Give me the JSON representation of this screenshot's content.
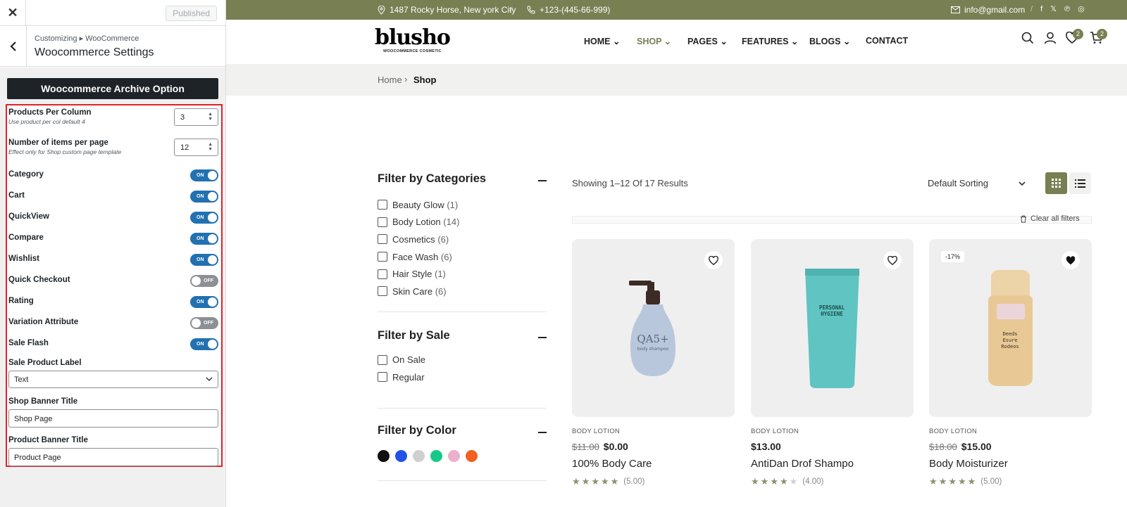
{
  "customizer": {
    "close_icon": "close-icon",
    "publish_label": "Published",
    "back_icon": "chevron-left-icon",
    "breadcrumb": "Customizing ▸ WooCommerce",
    "title": "Woocommerce Settings",
    "section_title": "Woocommerce Archive Option",
    "products_per_column": {
      "label": "Products Per Column",
      "desc": "Use product per col default 4",
      "value": "3"
    },
    "items_per_page": {
      "label": "Number of items per page",
      "desc": "Effect only for Shop custom page template",
      "value": "12"
    },
    "toggles": [
      {
        "label": "Category",
        "state": "ON"
      },
      {
        "label": "Cart",
        "state": "ON"
      },
      {
        "label": "QuickView",
        "state": "ON"
      },
      {
        "label": "Compare",
        "state": "ON"
      },
      {
        "label": "Wishlist",
        "state": "ON"
      },
      {
        "label": "Quick Checkout",
        "state": "OFF"
      },
      {
        "label": "Rating",
        "state": "ON"
      },
      {
        "label": "Variation Attribute",
        "state": "OFF"
      },
      {
        "label": "Sale Flash",
        "state": "ON"
      }
    ],
    "sale_label": {
      "label": "Sale Product Label",
      "value": "Text"
    },
    "shop_banner": {
      "label": "Shop Banner Title",
      "value": "Shop Page"
    },
    "product_banner": {
      "label": "Product Banner Title",
      "value": "Product Page"
    },
    "colors": {
      "accent": "#2271b1",
      "highlight_border": "#e0222a"
    }
  },
  "site": {
    "topbar": {
      "address": "1487 Rocky Horse, New york City",
      "phone": "+123-(445-66-999)",
      "email": "info@gmail.com",
      "social": [
        "facebook-icon",
        "x-icon",
        "pinterest-icon",
        "instagram-icon"
      ]
    },
    "logo": {
      "word": "blusho",
      "tagline": "WOOCOMMERCE COSMETIC"
    },
    "menu": [
      {
        "label": "HOME"
      },
      {
        "label": "SHOP"
      },
      {
        "label": "PAGES"
      },
      {
        "label": "FEATURES"
      },
      {
        "label": "BLOGS"
      },
      {
        "label": "CONTACT"
      }
    ],
    "wishlist_count": "2",
    "cart_count": "2",
    "breadcrumb": {
      "home": "Home",
      "current": "Shop"
    },
    "filters": {
      "categories_title": "Filter by Categories",
      "categories": [
        {
          "name": "Beauty Glow",
          "count": "(1)"
        },
        {
          "name": "Body Lotion",
          "count": "(14)"
        },
        {
          "name": "Cosmetics",
          "count": "(6)"
        },
        {
          "name": "Face Wash",
          "count": "(6)"
        },
        {
          "name": "Hair Style",
          "count": "(1)"
        },
        {
          "name": "Skin Care",
          "count": "(6)"
        }
      ],
      "sale_title": "Filter by Sale",
      "sale_options": [
        "On Sale",
        "Regular"
      ],
      "color_title": "Filter by Color",
      "colors": [
        "#111111",
        "#2451e6",
        "#cfcfcf",
        "#16c98b",
        "#eab0cc",
        "#f2601f"
      ]
    },
    "results_text": "Showing 1–12 Of 17 Results",
    "sorting": "Default Sorting",
    "clear_filters": "Clear all filters",
    "products": [
      {
        "category": "BODY LOTION",
        "old_price": "$11.00",
        "price": "$0.00",
        "name": "100% Body Care",
        "rating": 5,
        "rating_text": "(5.00)",
        "discount": ""
      },
      {
        "category": "BODY LOTION",
        "old_price": "",
        "price": "$13.00",
        "name": "AntiDan Drof Shampo",
        "rating": 4,
        "rating_text": "(4.00)",
        "discount": ""
      },
      {
        "category": "BODY LOTION",
        "old_price": "$18.00",
        "price": "$15.00",
        "name": "Body Moisturizer",
        "rating": 5,
        "rating_text": "(5.00)",
        "discount": "-17%"
      }
    ],
    "product_image_text": {
      "p1_brand": "QA5+",
      "p1_sub": "body shampoo",
      "p2_line1": "PERSONAL",
      "p2_line2": "HYGIENE",
      "p3_line1": "Deeds",
      "p3_line2": "Esure",
      "p3_line3": "Rodeos"
    },
    "brand_color": "#787f52"
  }
}
